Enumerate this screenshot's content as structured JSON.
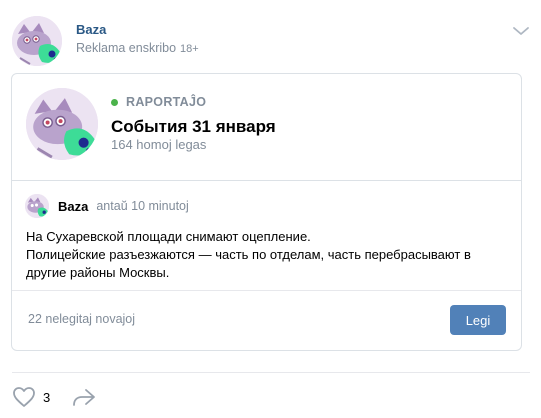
{
  "post": {
    "author": "Baza",
    "subtitle": "Reklama enskribo",
    "age_badge": "18+"
  },
  "card": {
    "live_label": "RAPORTAĴO",
    "title": "События 31 января",
    "viewers": "164 homoj legas"
  },
  "inner_post": {
    "author": "Baza",
    "time": "antaŭ 10 minutoj",
    "text": "На Сухаревской площади снимают оцепление.\nПолицейские разъезжаются — часть по отделам, часть перебрасывают в другие районы Москвы."
  },
  "footer": {
    "unread": "22 nelegitaj novajoj",
    "read_button": "Legi"
  },
  "actions": {
    "like_count": "3"
  },
  "colors": {
    "accent": "#5181b8",
    "link": "#2a5885",
    "live": "#4bb34b",
    "muted": "#818c99"
  },
  "icons": {
    "menu": "chevron-down-icon",
    "like": "heart-icon",
    "share": "share-arrow-icon"
  }
}
